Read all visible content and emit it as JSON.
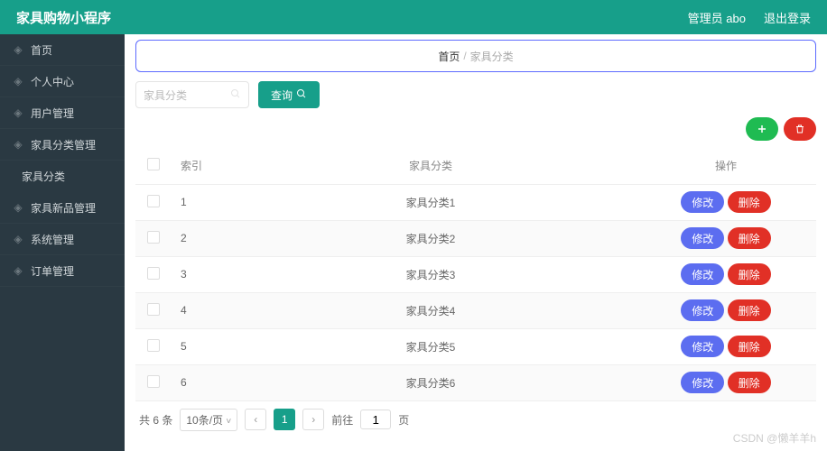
{
  "header": {
    "title": "家具购物小程序",
    "admin": "管理员 abo",
    "logout": "退出登录"
  },
  "sidebar": {
    "items": [
      {
        "label": "首页"
      },
      {
        "label": "个人中心"
      },
      {
        "label": "用户管理"
      },
      {
        "label": "家具分类管理"
      },
      {
        "label": "家具分类",
        "sub": true
      },
      {
        "label": "家具新品管理"
      },
      {
        "label": "系统管理"
      },
      {
        "label": "订单管理"
      }
    ]
  },
  "breadcrumb": {
    "home": "首页",
    "sep": "/",
    "current": "家具分类"
  },
  "search": {
    "placeholder": "家具分类",
    "button": "查询"
  },
  "table": {
    "headers": {
      "index": "索引",
      "category": "家具分类",
      "ops": "操作"
    },
    "rows": [
      {
        "idx": "1",
        "name": "家具分类1"
      },
      {
        "idx": "2",
        "name": "家具分类2"
      },
      {
        "idx": "3",
        "name": "家具分类3"
      },
      {
        "idx": "4",
        "name": "家具分类4"
      },
      {
        "idx": "5",
        "name": "家具分类5"
      },
      {
        "idx": "6",
        "name": "家具分类6"
      }
    ],
    "editLabel": "修改",
    "deleteLabel": "删除"
  },
  "pager": {
    "total": "共 6 条",
    "pageSize": "10条/页",
    "current": "1",
    "goto": "前往",
    "gotoVal": "1",
    "unit": "页"
  },
  "watermark": "CSDN @懒羊羊h"
}
